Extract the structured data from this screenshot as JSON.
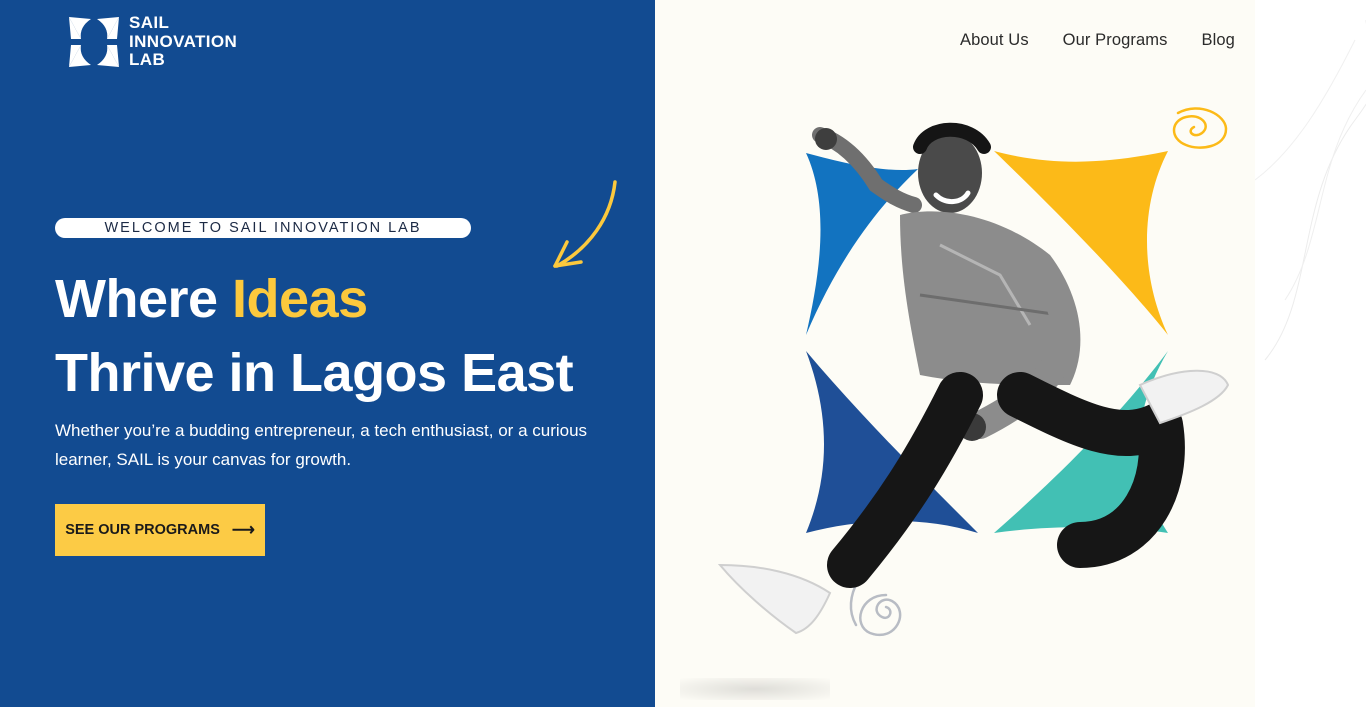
{
  "brand": {
    "name_line1": "SAIL",
    "name_line2": "INNOVATION",
    "name_line3": "LAB"
  },
  "nav": {
    "items": [
      {
        "label": "About Us"
      },
      {
        "label": "Our Programs"
      },
      {
        "label": "Blog"
      }
    ]
  },
  "hero": {
    "eyebrow": "WELCOME TO SAIL INNOVATION LAB",
    "headline_part1": "Where ",
    "headline_accent": "Ideas",
    "headline_line2": "Thrive in Lagos East",
    "subtext": "Whether you’re a budding entrepreneur, a tech enthusiast, or a curious learner, SAIL is your canvas for growth.",
    "cta_label": "SEE OUR PROGRAMS",
    "cta_arrow": "⟶"
  },
  "colors": {
    "primary_blue": "#124b91",
    "accent_yellow": "#fcc93d",
    "star_blue_light": "#1273c0",
    "star_blue_dark": "#1f4f97",
    "star_yellow": "#fcba18",
    "star_teal": "#42c0b4"
  },
  "icons": {
    "logo": "sail-logo-icon",
    "arrow": "arrow-right-icon",
    "doodle_arrow": "curved-arrow-doodle-icon",
    "squiggle": "squiggle-doodle-icon",
    "spiral": "spiral-doodle-icon"
  }
}
